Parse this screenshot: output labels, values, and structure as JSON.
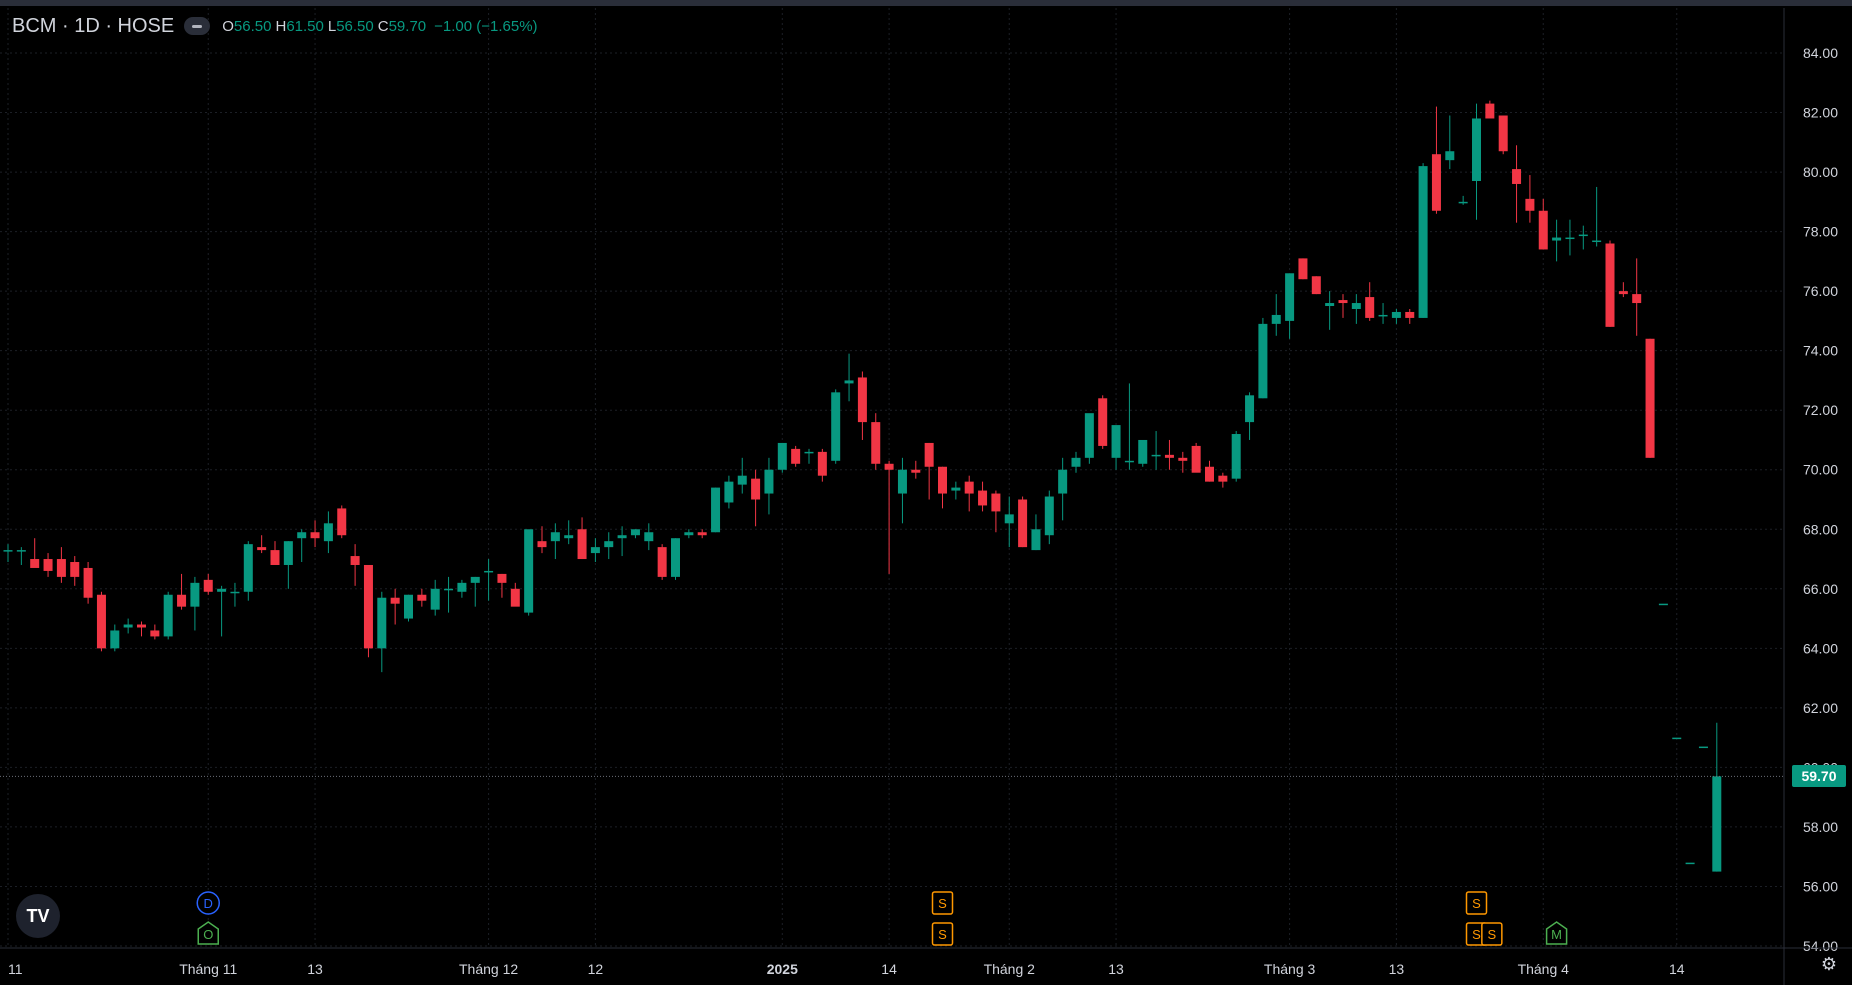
{
  "legend": {
    "symbol": "BCM · 1D · HOSE",
    "open_label": "O",
    "open": "56.50",
    "high_label": "H",
    "high": "61.50",
    "low_label": "L",
    "low": "56.50",
    "close_label": "C",
    "close": "59.70",
    "change": "−1.00 (−1.65%)"
  },
  "last_price_label": "59.70",
  "logo_text": "TV",
  "colors": {
    "up": "#089981",
    "down": "#f23645",
    "background": "#000000",
    "grid": "#1c1f26",
    "dividend": "#2962ff",
    "split": "#ff9800",
    "other": "#4caf50"
  },
  "chart_data": {
    "type": "candlestick",
    "title": "BCM · 1D · HOSE",
    "ylim": [
      54,
      84
    ],
    "grid": true,
    "y_ticks": [
      "54.00",
      "56.00",
      "58.00",
      "60.00",
      "62.00",
      "64.00",
      "66.00",
      "68.00",
      "70.00",
      "72.00",
      "74.00",
      "76.00",
      "78.00",
      "80.00",
      "82.00",
      "84.00"
    ],
    "x_ticks": [
      {
        "label": "11",
        "bar": 0
      },
      {
        "label": "Tháng 11",
        "bar": 15
      },
      {
        "label": "13",
        "bar": 23
      },
      {
        "label": "Tháng 12",
        "bar": 36
      },
      {
        "label": "12",
        "bar": 44
      },
      {
        "label": "2025",
        "bar": 58
      },
      {
        "label": "14",
        "bar": 66
      },
      {
        "label": "Tháng 2",
        "bar": 75
      },
      {
        "label": "13",
        "bar": 83
      },
      {
        "label": "Tháng 3",
        "bar": 96
      },
      {
        "label": "13",
        "bar": 104
      },
      {
        "label": "Tháng 4",
        "bar": 115
      },
      {
        "label": "14",
        "bar": 125
      }
    ],
    "candles": [
      [
        67.3,
        67.5,
        66.9,
        67.3
      ],
      [
        67.3,
        67.4,
        66.8,
        67.3
      ],
      [
        67.0,
        67.7,
        66.8,
        66.7
      ],
      [
        67.0,
        67.2,
        66.4,
        66.6
      ],
      [
        67.0,
        67.4,
        66.2,
        66.4
      ],
      [
        66.9,
        67.1,
        66.1,
        66.4
      ],
      [
        66.7,
        66.9,
        65.5,
        65.7
      ],
      [
        65.8,
        65.9,
        63.9,
        64.0
      ],
      [
        64.0,
        64.8,
        63.9,
        64.6
      ],
      [
        64.7,
        65.0,
        64.5,
        64.8
      ],
      [
        64.8,
        64.9,
        64.4,
        64.7
      ],
      [
        64.6,
        64.8,
        64.3,
        64.4
      ],
      [
        64.4,
        65.9,
        64.3,
        65.8
      ],
      [
        65.8,
        66.5,
        65.3,
        65.4
      ],
      [
        65.4,
        66.4,
        64.6,
        66.2
      ],
      [
        66.3,
        66.5,
        65.8,
        65.9
      ],
      [
        65.9,
        66.1,
        64.4,
        66.0
      ],
      [
        65.9,
        66.2,
        65.4,
        65.9
      ],
      [
        65.9,
        67.6,
        65.6,
        67.5
      ],
      [
        67.4,
        67.8,
        67.2,
        67.3
      ],
      [
        67.3,
        67.6,
        66.8,
        66.8
      ],
      [
        66.8,
        67.6,
        66.0,
        67.6
      ],
      [
        67.7,
        68.0,
        66.9,
        67.9
      ],
      [
        67.9,
        68.3,
        67.4,
        67.7
      ],
      [
        67.6,
        68.6,
        67.2,
        68.2
      ],
      [
        68.7,
        68.8,
        67.7,
        67.8
      ],
      [
        67.1,
        67.5,
        66.1,
        66.8
      ],
      [
        66.8,
        66.8,
        63.7,
        64.0
      ],
      [
        64.0,
        65.9,
        63.2,
        65.7
      ],
      [
        65.7,
        66.0,
        64.8,
        65.5
      ],
      [
        65.0,
        65.8,
        64.9,
        65.8
      ],
      [
        65.8,
        66.0,
        65.4,
        65.6
      ],
      [
        65.3,
        66.3,
        65.1,
        66.0
      ],
      [
        66.0,
        66.4,
        65.2,
        66.0
      ],
      [
        65.9,
        66.3,
        65.7,
        66.2
      ],
      [
        66.2,
        66.4,
        65.4,
        66.4
      ],
      [
        66.6,
        67.0,
        65.6,
        66.6
      ],
      [
        66.5,
        66.5,
        65.7,
        66.2
      ],
      [
        66.0,
        66.2,
        65.7,
        65.4
      ],
      [
        65.2,
        67.5,
        65.1,
        68.0
      ],
      [
        67.6,
        68.1,
        67.2,
        67.4
      ],
      [
        67.6,
        68.2,
        67.0,
        67.9
      ],
      [
        67.7,
        68.3,
        67.5,
        67.8
      ],
      [
        68.0,
        68.4,
        67.0,
        67.0
      ],
      [
        67.2,
        67.7,
        66.9,
        67.4
      ],
      [
        67.4,
        67.9,
        67.0,
        67.6
      ],
      [
        67.7,
        68.1,
        67.1,
        67.8
      ],
      [
        67.8,
        68.0,
        67.7,
        68.0
      ],
      [
        67.6,
        68.2,
        67.3,
        67.9
      ],
      [
        67.4,
        67.5,
        66.3,
        66.4
      ],
      [
        66.4,
        67.7,
        66.3,
        67.7
      ],
      [
        67.8,
        68.0,
        67.7,
        67.9
      ],
      [
        67.9,
        68.0,
        67.7,
        67.8
      ],
      [
        67.9,
        69.4,
        67.9,
        69.4
      ],
      [
        68.9,
        69.8,
        68.7,
        69.6
      ],
      [
        69.5,
        70.4,
        69.2,
        69.8
      ],
      [
        69.7,
        70.0,
        68.1,
        69.0
      ],
      [
        69.2,
        70.4,
        68.5,
        70.0
      ],
      [
        70.0,
        70.9,
        69.9,
        70.9
      ],
      [
        70.7,
        70.8,
        70.1,
        70.2
      ],
      [
        70.6,
        70.7,
        70.2,
        70.6
      ],
      [
        70.6,
        70.7,
        69.6,
        69.8
      ],
      [
        70.3,
        72.7,
        70.2,
        72.6
      ],
      [
        72.9,
        73.9,
        72.3,
        73.0
      ],
      [
        73.1,
        73.3,
        71.0,
        71.6
      ],
      [
        71.6,
        71.9,
        70.0,
        70.2
      ],
      [
        70.2,
        70.3,
        66.5,
        70.0
      ],
      [
        69.2,
        70.4,
        68.2,
        70.0
      ],
      [
        70.0,
        70.3,
        69.7,
        69.9
      ],
      [
        70.9,
        70.9,
        69.0,
        70.1
      ],
      [
        70.1,
        70.1,
        68.7,
        69.2
      ],
      [
        69.3,
        69.6,
        69.0,
        69.4
      ],
      [
        69.6,
        69.8,
        68.6,
        69.2
      ],
      [
        69.3,
        69.6,
        68.6,
        68.8
      ],
      [
        69.2,
        69.3,
        67.9,
        68.6
      ],
      [
        68.2,
        69.1,
        67.4,
        68.5
      ],
      [
        69.0,
        69.1,
        67.4,
        67.4
      ],
      [
        67.3,
        68.5,
        67.3,
        68.0
      ],
      [
        67.8,
        69.3,
        67.5,
        69.1
      ],
      [
        69.2,
        70.4,
        68.3,
        70.0
      ],
      [
        70.1,
        70.6,
        69.9,
        70.4
      ],
      [
        70.4,
        71.8,
        70.2,
        71.9
      ],
      [
        72.4,
        72.5,
        70.7,
        70.8
      ],
      [
        70.4,
        71.3,
        70.0,
        71.5
      ],
      [
        70.3,
        72.9,
        70.0,
        70.3
      ],
      [
        70.2,
        70.8,
        70.1,
        71.0
      ],
      [
        70.5,
        71.3,
        70.0,
        70.5
      ],
      [
        70.5,
        71.0,
        70.0,
        70.4
      ],
      [
        70.4,
        70.6,
        69.9,
        70.3
      ],
      [
        70.8,
        70.9,
        70.2,
        69.9
      ],
      [
        70.1,
        70.3,
        69.6,
        69.6
      ],
      [
        69.8,
        69.9,
        69.4,
        69.6
      ],
      [
        69.7,
        71.3,
        69.6,
        71.2
      ],
      [
        71.6,
        72.6,
        71.0,
        72.5
      ],
      [
        72.4,
        75.1,
        72.4,
        74.9
      ],
      [
        74.9,
        75.9,
        74.5,
        75.2
      ],
      [
        75.0,
        76.5,
        74.4,
        76.6
      ],
      [
        77.1,
        77.1,
        76.4,
        76.4
      ],
      [
        76.5,
        76.5,
        75.9,
        75.9
      ],
      [
        75.5,
        76.0,
        74.7,
        75.6
      ],
      [
        75.7,
        75.9,
        75.1,
        75.6
      ],
      [
        75.4,
        75.9,
        74.9,
        75.6
      ],
      [
        75.8,
        76.3,
        75.0,
        75.1
      ],
      [
        75.2,
        75.6,
        74.9,
        75.2
      ],
      [
        75.1,
        75.4,
        74.9,
        75.3
      ],
      [
        75.3,
        75.4,
        74.9,
        75.1
      ],
      [
        75.1,
        80.3,
        75.1,
        80.2
      ],
      [
        80.6,
        82.2,
        78.6,
        78.7
      ],
      [
        80.4,
        81.9,
        80.1,
        80.7
      ],
      [
        79.0,
        79.2,
        78.9,
        79.0
      ],
      [
        79.7,
        82.3,
        78.4,
        81.8
      ],
      [
        82.3,
        82.4,
        81.9,
        81.8
      ],
      [
        81.9,
        81.9,
        80.6,
        80.7
      ],
      [
        80.1,
        80.9,
        78.3,
        79.6
      ],
      [
        79.1,
        79.9,
        78.3,
        78.7
      ],
      [
        78.7,
        79.1,
        77.5,
        77.4
      ],
      [
        77.7,
        78.4,
        77.0,
        77.8
      ],
      [
        77.8,
        78.4,
        77.2,
        77.8
      ],
      [
        77.9,
        78.2,
        77.4,
        77.9
      ],
      [
        77.7,
        79.5,
        77.5,
        77.7
      ],
      [
        77.6,
        77.7,
        74.8,
        74.8
      ],
      [
        76.0,
        76.3,
        75.8,
        75.9
      ],
      [
        75.9,
        77.1,
        74.5,
        75.6
      ],
      [
        74.4,
        74.4,
        70.4,
        70.4
      ],
      [
        65.5,
        65.5,
        65.5,
        65.5
      ],
      [
        61.0,
        61.0,
        61.0,
        61.0
      ],
      [
        56.8,
        56.8,
        56.8,
        56.8
      ],
      [
        60.7,
        60.7,
        60.7,
        60.7
      ],
      [
        56.5,
        61.5,
        56.5,
        59.7
      ]
    ],
    "events": [
      {
        "bar": 15,
        "kind": "dividend",
        "letter": "D",
        "row": 1
      },
      {
        "bar": 15,
        "kind": "other",
        "letter": "O",
        "row": 2
      },
      {
        "bar": 70,
        "kind": "split",
        "letter": "S",
        "row": 1
      },
      {
        "bar": 70,
        "kind": "split",
        "letter": "S",
        "row": 2
      },
      {
        "bar": 110,
        "kind": "split",
        "letter": "S",
        "row": 1
      },
      {
        "bar": 110,
        "kind": "split",
        "letter": "S",
        "row": 2
      },
      {
        "bar": 111,
        "kind": "split",
        "letter": "S",
        "row": 2
      },
      {
        "bar": 116,
        "kind": "other",
        "letter": "M",
        "row": 2
      }
    ]
  }
}
